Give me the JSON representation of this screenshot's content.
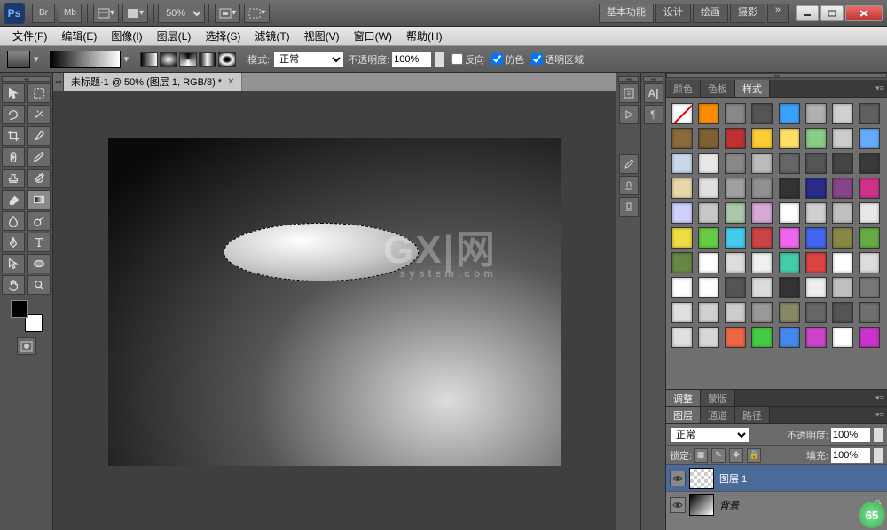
{
  "titlebar": {
    "zoom": "50%",
    "modes": [
      "基本功能",
      "设计",
      "绘画",
      "摄影"
    ],
    "more": "»"
  },
  "menubar": {
    "file": "文件(F)",
    "edit": "编辑(E)",
    "image": "图像(I)",
    "layer": "图层(L)",
    "select": "选择(S)",
    "filter": "滤镜(T)",
    "view": "视图(V)",
    "window": "窗口(W)",
    "help": "帮助(H)"
  },
  "optbar": {
    "mode_label": "模式:",
    "mode_value": "正常",
    "opacity_label": "不透明度:",
    "opacity_value": "100%",
    "reverse": "反向",
    "dither": "仿色",
    "trans": "透明区域"
  },
  "doc": {
    "tab": "未标题-1 @ 50% (图层 1, RGB/8) *"
  },
  "watermark": {
    "big": "GX|网",
    "sub": "system.com"
  },
  "panels": {
    "top_tabs": [
      "颜色",
      "色板",
      "样式"
    ],
    "adj_tabs": [
      "调整",
      "蒙版"
    ],
    "layer_tabs": [
      "图层",
      "通道",
      "路径"
    ],
    "blend_mode": "正常",
    "opacity_label": "不透明度:",
    "opacity_value": "100%",
    "lock_label": "锁定:",
    "fill_label": "填充:",
    "fill_value": "100%",
    "layer1": "图层 1",
    "background": "背景"
  },
  "styles": {
    "colors": [
      "#ffffff00",
      "#ff8c00",
      "#888888",
      "#555555",
      "#3aa0ff",
      "#b0b0b0",
      "#d0d0d0",
      "#606060",
      "#8a6a3a",
      "#806030",
      "#c03030",
      "#ffcc33",
      "#ffe066",
      "#88cc88",
      "#cccccc",
      "#66aaff",
      "#c8d8e8",
      "#e8e8e8",
      "#888888",
      "#bbbbbb",
      "#666666",
      "#555555",
      "#444444",
      "#3a3a3a",
      "#e8d8a8",
      "#e0e0e0",
      "#a0a0a0",
      "#909090",
      "#333333",
      "#2a2a8a",
      "#884488",
      "#cc3388",
      "#d0d0ff",
      "#c8c8c8",
      "#a8c8a8",
      "#d8a8d8",
      "#ffffff",
      "#d0d0d0",
      "#c0c0c0",
      "#e8e8e8",
      "#eedd44",
      "#66cc44",
      "#44ccee",
      "#cc4444",
      "#ee66ee",
      "#4466ee",
      "#888844",
      "#66aa44",
      "#668844",
      "#ffffff",
      "#dddddd",
      "#f0f0f0",
      "#44ccaa",
      "#dd4444",
      "#ffffff",
      "#dddddd",
      "#ffffff",
      "#ffffff",
      "#555555",
      "#dddddd",
      "#333333",
      "#eeeeee",
      "#c0c0c0",
      "#777777",
      "#e0e0e0",
      "#d0d0d0",
      "#cccccc",
      "#999999",
      "#888866",
      "#666666",
      "#555555",
      "#707070",
      "#e0e0e0",
      "#d8d8d8",
      "#ee6644",
      "#44cc44",
      "#4488ee",
      "#cc44cc",
      "#ffffff",
      "#cc33cc"
    ]
  },
  "badge": "65"
}
